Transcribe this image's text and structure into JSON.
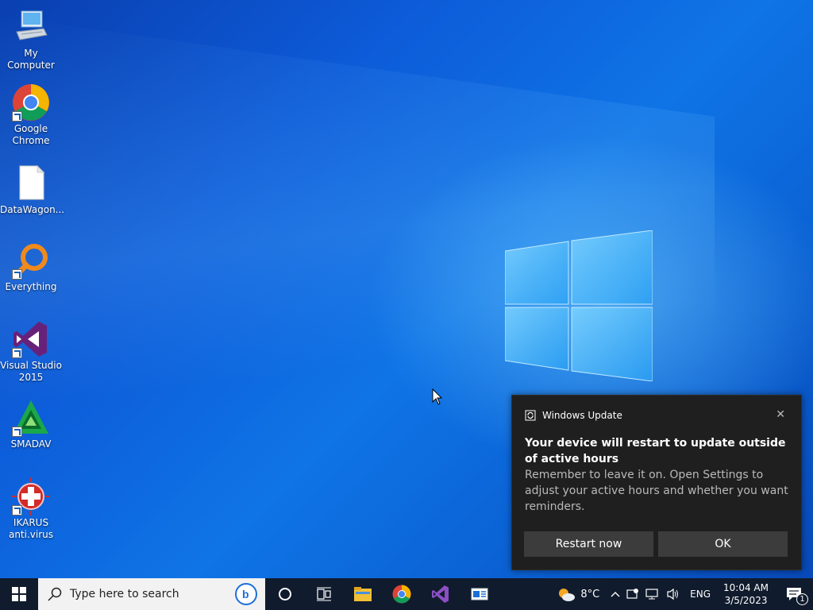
{
  "desktop_icons": [
    {
      "label": "My Computer",
      "icon": "computer-icon"
    },
    {
      "label": "Google Chrome",
      "icon": "chrome-icon"
    },
    {
      "label": "DataWagon...",
      "icon": "file-icon"
    },
    {
      "label": "Everything",
      "icon": "everything-icon"
    },
    {
      "label": "Visual Studio 2015",
      "icon": "visual-studio-icon"
    },
    {
      "label": "SMADAV",
      "icon": "smadav-icon"
    },
    {
      "label": "IKARUS anti.virus",
      "icon": "ikarus-icon"
    }
  ],
  "toast": {
    "app": "Windows Update",
    "title": "Your device will restart to update outside of active hours",
    "body": "Remember to leave it on. Open Settings to adjust your active hours and whether you want reminders.",
    "restart_label": "Restart now",
    "ok_label": "OK",
    "close_glyph": "✕"
  },
  "taskbar": {
    "search_placeholder": "Type here to search",
    "pinned": [
      "cortana-icon",
      "task-view-icon",
      "file-explorer-icon",
      "chrome-icon",
      "visual-studio-icon",
      "app-window-icon"
    ],
    "weather": "8°C",
    "language": "ENG",
    "time": "10:04 AM",
    "date": "3/5/2023",
    "notifications_count": "1"
  },
  "colors": {
    "taskbar_bg": "#101b2d",
    "toast_bg": "#1f1f1f",
    "button_bg": "#3c3c3c",
    "wallpaper_blue": "#0d5bd8"
  }
}
